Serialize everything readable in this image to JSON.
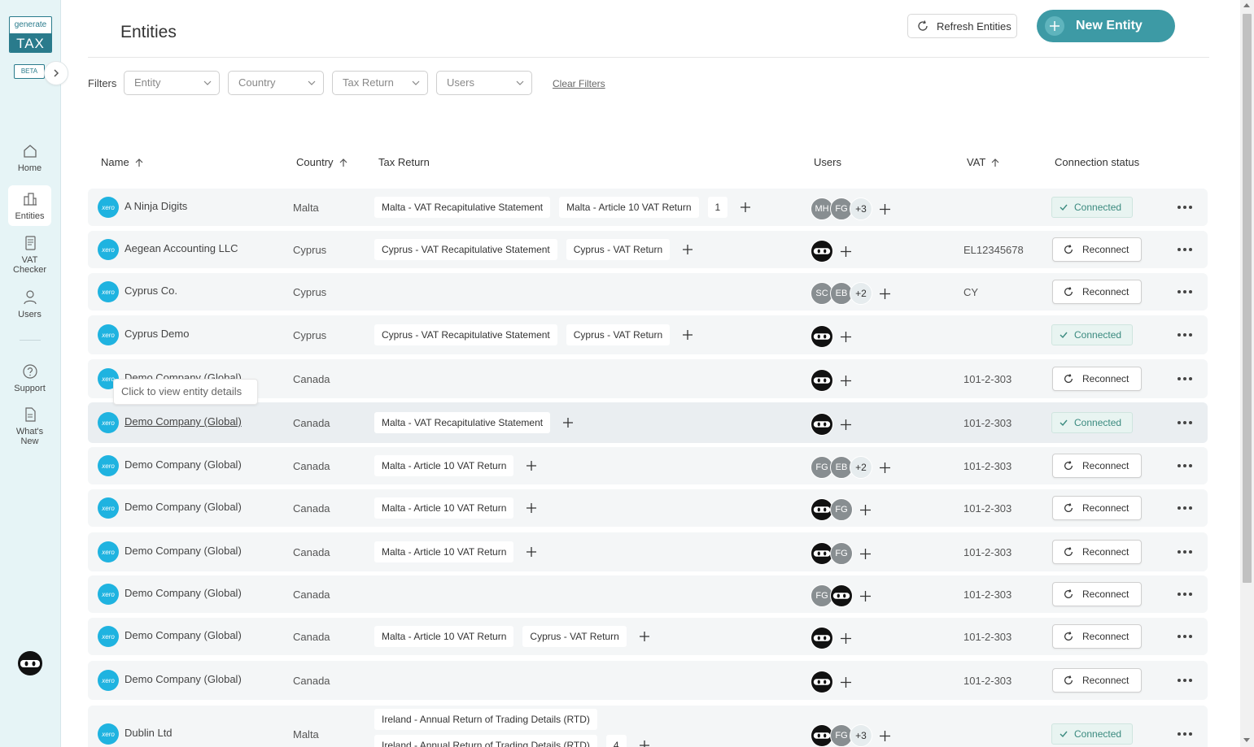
{
  "sidebar": {
    "logo_top": "generate",
    "logo_bottom": "TAX",
    "beta": "BETA",
    "items": [
      {
        "label": "Home",
        "icon": "home-icon"
      },
      {
        "label": "Entities",
        "icon": "building-icon"
      },
      {
        "label": "VAT Checker",
        "icon": "document-icon"
      },
      {
        "label": "Users",
        "icon": "user-icon"
      },
      {
        "label": "Support",
        "icon": "help-icon"
      },
      {
        "label": "What's New",
        "icon": "file-icon"
      }
    ]
  },
  "header": {
    "title": "Entities",
    "refresh_label": "Refresh Entities",
    "new_label": "New Entity"
  },
  "filters": {
    "label": "Filters",
    "entity": "Entity",
    "country": "Country",
    "tax_return": "Tax Return",
    "users": "Users",
    "clear": "Clear Filters"
  },
  "columns": {
    "name": "Name",
    "country": "Country",
    "tax_return": "Tax Return",
    "users": "Users",
    "vat": "VAT",
    "connection": "Connection status"
  },
  "xero_label": "xero",
  "tooltip": "Click to view entity details",
  "status": {
    "connected": "Connected",
    "reconnect": "Reconnect"
  },
  "rows": [
    {
      "name": "A Ninja Digits",
      "country": "Malta",
      "tags": [
        "Malta - VAT Recapitulative Statement",
        "Malta - Article 10 VAT Return"
      ],
      "count": "1",
      "users": [
        "MH",
        "FG"
      ],
      "more": "+3",
      "vat": "",
      "status": "connected"
    },
    {
      "name": "Aegean Accounting LLC",
      "country": "Cyprus",
      "tags": [
        "Cyprus - VAT Recapitulative Statement",
        "Cyprus - VAT Return"
      ],
      "count": "",
      "users": [
        "ninja"
      ],
      "more": "",
      "vat": "EL12345678",
      "status": "reconnect"
    },
    {
      "name": "Cyprus Co.",
      "country": "Cyprus",
      "tags": [],
      "count": "",
      "users": [
        "SC",
        "EB"
      ],
      "more": "+2",
      "vat": "CY",
      "status": "reconnect"
    },
    {
      "name": "Cyprus Demo",
      "country": "Cyprus",
      "tags": [
        "Cyprus - VAT Recapitulative Statement",
        "Cyprus - VAT Return"
      ],
      "count": "",
      "users": [
        "ninja"
      ],
      "more": "",
      "vat": "",
      "status": "connected"
    },
    {
      "name": "Demo Company (Global)",
      "country": "Canada",
      "tags": [],
      "count": "",
      "users": [
        "ninja"
      ],
      "more": "",
      "vat": "101-2-303",
      "status": "reconnect"
    },
    {
      "name": "Demo Company (Global)",
      "country": "Canada",
      "tags": [
        "Malta - VAT Recapitulative Statement"
      ],
      "count": "",
      "users": [
        "ninja"
      ],
      "more": "",
      "vat": "101-2-303",
      "status": "connected"
    },
    {
      "name": "Demo Company (Global)",
      "country": "Canada",
      "tags": [
        "Malta - Article 10 VAT Return"
      ],
      "count": "",
      "users": [
        "FG",
        "EB"
      ],
      "more": "+2",
      "vat": "101-2-303",
      "status": "reconnect"
    },
    {
      "name": "Demo Company (Global)",
      "country": "Canada",
      "tags": [
        "Malta - Article 10 VAT Return"
      ],
      "count": "",
      "users": [
        "ninja",
        "FG"
      ],
      "more": "",
      "vat": "101-2-303",
      "status": "reconnect"
    },
    {
      "name": "Demo Company (Global)",
      "country": "Canada",
      "tags": [
        "Malta - Article 10 VAT Return"
      ],
      "count": "",
      "users": [
        "ninja",
        "FG"
      ],
      "more": "",
      "vat": "101-2-303",
      "status": "reconnect"
    },
    {
      "name": "Demo Company (Global)",
      "country": "Canada",
      "tags": [],
      "count": "",
      "users": [
        "FG",
        "ninja"
      ],
      "more": "",
      "vat": "101-2-303",
      "status": "reconnect"
    },
    {
      "name": "Demo Company (Global)",
      "country": "Canada",
      "tags": [
        "Malta - Article 10 VAT Return",
        "Cyprus - VAT Return"
      ],
      "count": "",
      "users": [
        "ninja"
      ],
      "more": "",
      "vat": "101-2-303",
      "status": "reconnect"
    },
    {
      "name": "Demo Company (Global)",
      "country": "Canada",
      "tags": [],
      "count": "",
      "users": [
        "ninja"
      ],
      "more": "",
      "vat": "101-2-303",
      "status": "reconnect"
    },
    {
      "name": "Dublin Ltd",
      "country": "Malta",
      "tags": [
        "Ireland - Annual Return of Trading Details (RTD)",
        "Ireland - Annual Return of Trading Details (RTD)"
      ],
      "count": "4",
      "users": [
        "ninja",
        "FG"
      ],
      "more": "+3",
      "vat": "",
      "status": "connected"
    }
  ]
}
